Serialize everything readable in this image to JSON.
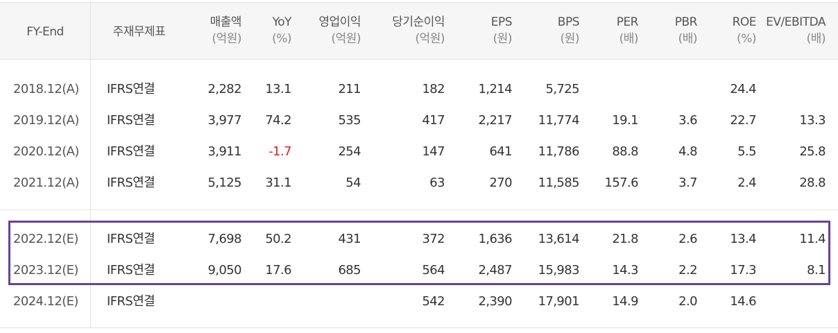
{
  "table": {
    "headers": [
      {
        "main": "FY-End",
        "sub": ""
      },
      {
        "main": "주재무제표",
        "sub": ""
      },
      {
        "main": "매출액",
        "sub": "(억원)"
      },
      {
        "main": "YoY",
        "sub": "(%)"
      },
      {
        "main": "영업이익",
        "sub": "(억원)"
      },
      {
        "main": "당기순이익",
        "sub": "(억원)"
      },
      {
        "main": "EPS",
        "sub": "(원)"
      },
      {
        "main": "BPS",
        "sub": "(원)"
      },
      {
        "main": "PER",
        "sub": "(배)"
      },
      {
        "main": "PBR",
        "sub": "(배)"
      },
      {
        "main": "ROE",
        "sub": "(%)"
      },
      {
        "main": "EV/EBITDA",
        "sub": "(배)"
      }
    ],
    "rows": [
      {
        "fy": "2018.12(A)",
        "basis": "IFRS연결",
        "sales": "2,282",
        "yoy": "13.1",
        "op": "211",
        "net": "182",
        "eps": "1,214",
        "bps": "5,725",
        "per": "",
        "pbr": "",
        "roe": "24.4",
        "ev": ""
      },
      {
        "fy": "2019.12(A)",
        "basis": "IFRS연결",
        "sales": "3,977",
        "yoy": "74.2",
        "op": "535",
        "net": "417",
        "eps": "2,217",
        "bps": "11,774",
        "per": "19.1",
        "pbr": "3.6",
        "roe": "22.7",
        "ev": "13.3"
      },
      {
        "fy": "2020.12(A)",
        "basis": "IFRS연결",
        "sales": "3,911",
        "yoy": "-1.7",
        "op": "254",
        "net": "147",
        "eps": "641",
        "bps": "11,786",
        "per": "88.8",
        "pbr": "4.8",
        "roe": "5.5",
        "ev": "25.8"
      },
      {
        "fy": "2021.12(A)",
        "basis": "IFRS연결",
        "sales": "5,125",
        "yoy": "31.1",
        "op": "54",
        "net": "63",
        "eps": "270",
        "bps": "11,585",
        "per": "157.6",
        "pbr": "3.7",
        "roe": "2.4",
        "ev": "28.8"
      },
      {
        "fy": "2022.12(E)",
        "basis": "IFRS연결",
        "sales": "7,698",
        "yoy": "50.2",
        "op": "431",
        "net": "372",
        "eps": "1,636",
        "bps": "13,614",
        "per": "21.8",
        "pbr": "2.6",
        "roe": "13.4",
        "ev": "11.4"
      },
      {
        "fy": "2023.12(E)",
        "basis": "IFRS연결",
        "sales": "9,050",
        "yoy": "17.6",
        "op": "685",
        "net": "564",
        "eps": "2,487",
        "bps": "15,983",
        "per": "14.3",
        "pbr": "2.2",
        "roe": "17.3",
        "ev": "8.1"
      },
      {
        "fy": "2024.12(E)",
        "basis": "IFRS연결",
        "sales": "",
        "yoy": "",
        "op": "",
        "net": "542",
        "eps": "2,390",
        "bps": "17,901",
        "per": "14.9",
        "pbr": "2.0",
        "roe": "14.6",
        "ev": ""
      }
    ]
  },
  "colors": {
    "negative": "#e02020",
    "highlight_border": "#6a3fa0",
    "header_bg": "#f6f6f6"
  }
}
